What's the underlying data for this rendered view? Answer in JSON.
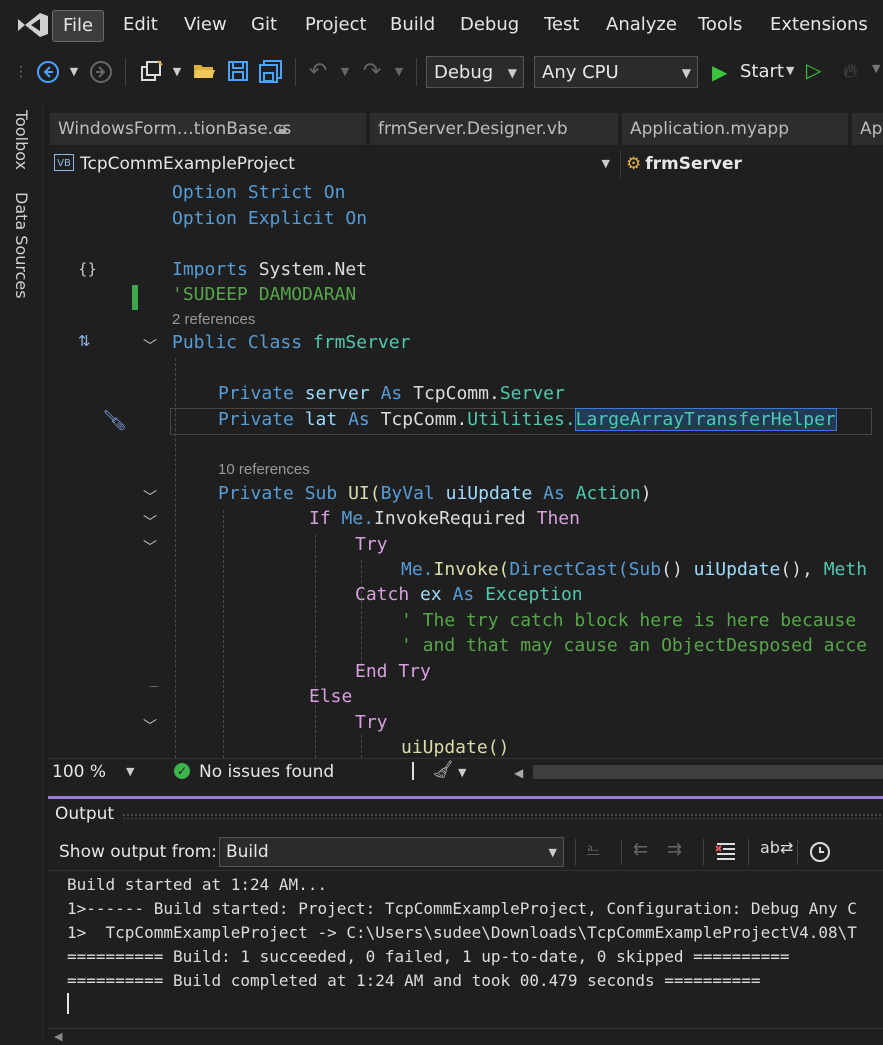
{
  "menu": [
    "File",
    "Edit",
    "View",
    "Git",
    "Project",
    "Build",
    "Debug",
    "Test",
    "Analyze",
    "Tools",
    "Extensions"
  ],
  "toolbar": {
    "config": "Debug",
    "platform": "Any CPU",
    "start": "Start"
  },
  "rail": [
    "Toolbox",
    "Data Sources"
  ],
  "tabs": [
    "WindowsForm…tionBase.cs",
    "frmServer.Designer.vb",
    "Application.myapp",
    "Ap"
  ],
  "nav": {
    "project": "TcpCommExampleProject",
    "member": "frmServer",
    "vb_badge": "VB"
  },
  "code": {
    "l1a": "Option Strict",
    "l1b": "On",
    "l2a": "Option Explicit",
    "l2b": "On",
    "l3a": "Imports",
    "l3b": "System.Net",
    "l4": "'SUDEEP DAMODARAN",
    "refs1": "2 references",
    "l5a": "Public Class",
    "l5b": "frmServer",
    "l6a": "Private",
    "l6b": "server",
    "l6c": "As",
    "l6d": "TcpComm.",
    "l6e": "Server",
    "l7a": "Private",
    "l7b": "lat",
    "l7c": "As",
    "l7d": "TcpComm.",
    "l7e": "Utilities.",
    "l7f": "LargeArrayTransferHelper",
    "refs2": "10 references",
    "l8a": "Private Sub",
    "l8b": "UI(",
    "l8c": "ByVal",
    "l8d": "uiUpdate",
    "l8e": "As",
    "l8f": "Action",
    "l8g": ")",
    "l9a": "If",
    "l9b": "Me.",
    "l9c": "InvokeRequired",
    "l9d": "Then",
    "l10": "Try",
    "l11a": "Me.",
    "l11b": "Invoke(",
    "l11c": "DirectCast(",
    "l11d": "Sub",
    "l11e": "() ",
    "l11f": "uiUpdate",
    "l11g": "(), ",
    "l11h": "Meth",
    "l12a": "Catch",
    "l12b": "ex",
    "l12c": "As",
    "l12d": "Exception",
    "l13": "' The try catch block here is here because",
    "l14": "' and that may cause an ObjectDesposed acce",
    "l15": "End Try",
    "l16": "Else",
    "l17": "Try",
    "l18": "uiUpdate()"
  },
  "status": {
    "zoom": "100 %",
    "issues": "No issues found"
  },
  "output": {
    "title": "Output",
    "show_from_label": "Show output from:",
    "source": "Build",
    "lines": [
      "Build started at 1:24 AM...",
      "1>------ Build started: Project: TcpCommExampleProject, Configuration: Debug Any C",
      "1>  TcpCommExampleProject -> C:\\Users\\sudee\\Downloads\\TcpCommExampleProjectV4.08\\T",
      "========== Build: 1 succeeded, 0 failed, 1 up-to-date, 0 skipped ==========",
      "========== Build completed at 1:24 AM and took 00.479 seconds =========="
    ]
  }
}
